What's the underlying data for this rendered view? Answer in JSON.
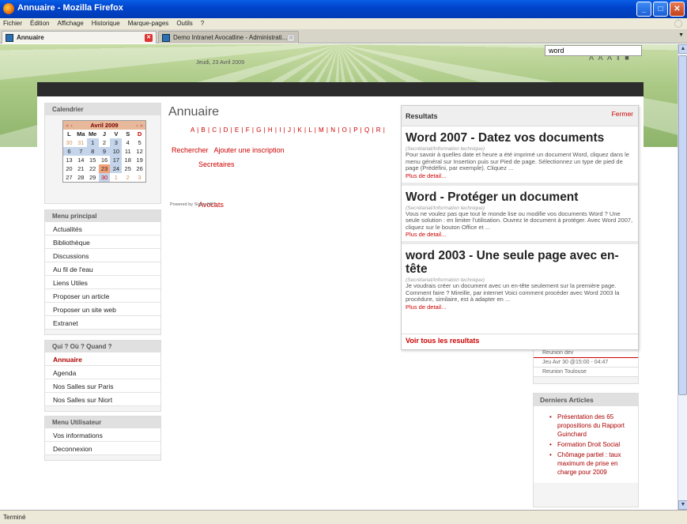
{
  "window": {
    "title": "Annuaire - Mozilla Firefox",
    "buttons": [
      "_",
      "□",
      "✕"
    ]
  },
  "menubar": [
    "Fichier",
    "Édition",
    "Affichage",
    "Historique",
    "Marque-pages",
    "Outils",
    "?"
  ],
  "tabs": [
    {
      "label": "Annuaire",
      "active": true
    },
    {
      "label": "Demo Intranet Avocatline - Administrati...",
      "active": false
    }
  ],
  "header": {
    "date": "Jeudi, 23 Avril 2009",
    "font_sizes": "A A A ‖ ■"
  },
  "top_search": {
    "value": "word"
  },
  "calendar": {
    "title": "Calendrier",
    "month": "Avril 2009",
    "prev": "« ‹",
    "next": "› »",
    "days": [
      "L",
      "Ma",
      "Me",
      "J",
      "V",
      "S",
      "D"
    ],
    "weeks": [
      [
        "30",
        "31",
        "1",
        "2",
        "3",
        "4",
        "5"
      ],
      [
        "6",
        "7",
        "8",
        "9",
        "10",
        "11",
        "12"
      ],
      [
        "13",
        "14",
        "15",
        "16",
        "17",
        "18",
        "19"
      ],
      [
        "20",
        "21",
        "22",
        "23",
        "24",
        "25",
        "26"
      ],
      [
        "27",
        "28",
        "29",
        "30",
        "1",
        "2",
        "3"
      ]
    ]
  },
  "menu_principal": {
    "title": "Menu principal",
    "items": [
      "Actualités",
      "Bibliothèque",
      "Discussions",
      "Au fil de l'eau",
      "Liens Utiles",
      "Proposer un article",
      "Proposer un site web",
      "Extranet"
    ]
  },
  "qui_ou_quand": {
    "title": "Qui ? Où ? Quand ?",
    "items": [
      "Annuaire",
      "Agenda",
      "Nos Salles sur Paris",
      "Nos Salles sur Niort"
    ]
  },
  "menu_utilisateur": {
    "title": "Menu Utilisateur",
    "items": [
      "Vos informations",
      "Deconnexion"
    ]
  },
  "main": {
    "title": "Annuaire",
    "alphabet": "A | B | C | D | E | F | G | H | I | J | K | L | M | N | O | P | Q | R |",
    "search_link": "Rechercher",
    "add_link": "Ajouter une inscription",
    "secretaires": "Secretaires",
    "avocats": "Avocats",
    "powered": "Powered by Sigsiu.NET"
  },
  "results": {
    "title": "Resultats",
    "close": "Fermer",
    "items": [
      {
        "title": "Word 2007 - Datez vos documents",
        "category": "(Secrétariat/Information technique)",
        "summary": "Pour savoir à quelles date et heure a été imprimé un document Word, cliquez dans le menu général sur Insertion puis sur Pied de page. Sélectionnez un type de pied de page (Prédéfini, par exemple). Cliquez ...",
        "more": "Plus de detail..."
      },
      {
        "title": "Word - Protéger un document",
        "category": "(Secrétariat/Information technique)",
        "summary": "Vous ne voulez pas  que tout le monde lise ou modifie vos documents Word ? Une seule solution : en limiter l'utilisation. Ouvrez le document à protéger. Avec Word 2007, cliquez sur le bouton Office et ...",
        "more": "Plus de detail..."
      },
      {
        "title": "word 2003 - Une seule page avec en-tête",
        "category": "(Secrétariat/Information technique)",
        "summary": " Je voudrais créer un document avec un en-tête seulement sur la première page. Comment faire ? Mireille, par internet Voici comment procéder avec Word 2003 la procédure, similaire, est à adapter en ...",
        "more": "Plus de detail..."
      }
    ],
    "see_all": "Voir tous les resultats"
  },
  "agenda": {
    "events": [
      "Reunion dev",
      "Jeu Avr 30 @15:00 - 04:47",
      "Reunion Toulouse"
    ]
  },
  "derniers_articles": {
    "title": "Derniers Articles",
    "items": [
      "Présentation des 65 propositions du Rapport Guinchard",
      "Formation Droit Social",
      "Chômage partiel : taux maximum de prise en charge pour 2009"
    ]
  },
  "statusbar": {
    "text": "Terminé"
  },
  "colors": {
    "accent": "#cc0000",
    "titlebar": "#0044cc",
    "banner": "#aac985"
  }
}
